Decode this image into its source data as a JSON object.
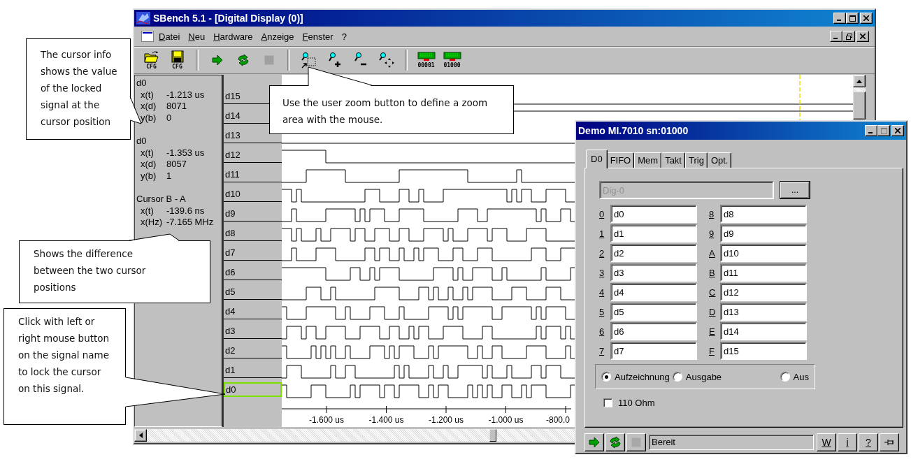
{
  "window": {
    "title": "SBench 5.1 - [Digital Display (0)]"
  },
  "menu": [
    "Datei",
    "Neu",
    "Hardware",
    "Anzeige",
    "Fenster",
    "?"
  ],
  "toolbar": [
    {
      "kind": "open",
      "caption": "CFG",
      "disabled": false
    },
    {
      "kind": "save",
      "caption": "CFG",
      "disabled": false
    },
    {
      "kind": "separator"
    },
    {
      "kind": "run",
      "disabled": false
    },
    {
      "kind": "refresh",
      "disabled": false
    },
    {
      "kind": "stop",
      "disabled": true
    },
    {
      "kind": "separator"
    },
    {
      "kind": "zoom-area",
      "disabled": false
    },
    {
      "kind": "zoom-in",
      "disabled": false
    },
    {
      "kind": "zoom-out",
      "disabled": false
    },
    {
      "kind": "zoom-fit",
      "disabled": false
    },
    {
      "kind": "separator"
    },
    {
      "kind": "board",
      "caption": "00001",
      "disabled": false
    },
    {
      "kind": "board",
      "caption": "01000",
      "disabled": false
    }
  ],
  "cursor_info": [
    {
      "title": "d0",
      "rows": [
        {
          "label": "x(t)",
          "value": "-1.213 us"
        },
        {
          "label": "x(d)",
          "value": "8071"
        },
        {
          "label": "y(b)",
          "value": "0"
        }
      ]
    },
    {
      "title": "d0",
      "rows": [
        {
          "label": "x(t)",
          "value": "-1.353 us"
        },
        {
          "label": "x(d)",
          "value": "8057"
        },
        {
          "label": "y(b)",
          "value": "1"
        }
      ]
    },
    {
      "title": "Cursor B - A",
      "rows": [
        {
          "label": "x(t)",
          "value": "-139.6 ns"
        },
        {
          "label": "x(Hz)",
          "value": "-7.165 MHz"
        }
      ]
    }
  ],
  "signals": [
    {
      "name": "d15",
      "selected": false
    },
    {
      "name": "d14",
      "selected": false
    },
    {
      "name": "d13",
      "selected": false
    },
    {
      "name": "d12",
      "selected": false
    },
    {
      "name": "d11",
      "selected": false
    },
    {
      "name": "d10",
      "selected": false
    },
    {
      "name": "d9",
      "selected": false
    },
    {
      "name": "d8",
      "selected": false
    },
    {
      "name": "d7",
      "selected": false
    },
    {
      "name": "d6",
      "selected": false
    },
    {
      "name": "d5",
      "selected": false
    },
    {
      "name": "d4",
      "selected": false
    },
    {
      "name": "d3",
      "selected": false
    },
    {
      "name": "d2",
      "selected": false
    },
    {
      "name": "d1",
      "selected": false
    },
    {
      "name": "d0",
      "selected": true
    }
  ],
  "time_axis": [
    "-1.600 us",
    "-1.400 us",
    "-1.200 us",
    "-1.000 us",
    "-800.0"
  ],
  "callouts": [
    {
      "text": "The cursor info shows the value of the locked signal at the cursor position"
    },
    {
      "text": "Use the user zoom button to define a zoom area with the mouse."
    },
    {
      "text": "Shows the difference between the two cursor positions"
    },
    {
      "text": "Click with left or right mouse button on the signal name to lock the cursor on this signal."
    }
  ],
  "dialog": {
    "title": "Demo MI.7010 sn:01000",
    "tabs": [
      {
        "label": "D0",
        "selected": true
      },
      {
        "label": "FIFO",
        "selected": false
      },
      {
        "label": "Mem",
        "selected": false
      },
      {
        "label": "Takt",
        "selected": false
      },
      {
        "label": "Trig",
        "selected": false
      },
      {
        "label": "Opt.",
        "selected": false
      }
    ],
    "name_field": {
      "value": "Dig-0",
      "disabled": true
    },
    "browse_button": "...",
    "channels": [
      {
        "key": "0",
        "name": "d0"
      },
      {
        "key": "1",
        "name": "d1"
      },
      {
        "key": "2",
        "name": "d2"
      },
      {
        "key": "3",
        "name": "d3"
      },
      {
        "key": "4",
        "name": "d4"
      },
      {
        "key": "5",
        "name": "d5"
      },
      {
        "key": "6",
        "name": "d6"
      },
      {
        "key": "7",
        "name": "d7"
      },
      {
        "key": "8",
        "name": "d8"
      },
      {
        "key": "9",
        "name": "d9"
      },
      {
        "key": "A",
        "name": "d10"
      },
      {
        "key": "B",
        "name": "d11"
      },
      {
        "key": "C",
        "name": "d12"
      },
      {
        "key": "D",
        "name": "d13"
      },
      {
        "key": "E",
        "name": "d14"
      },
      {
        "key": "F",
        "name": "d15"
      }
    ],
    "modes": [
      {
        "label": "Aufzeichnung",
        "selected": true
      },
      {
        "label": "Ausgabe",
        "selected": false
      },
      {
        "label": "Aus",
        "selected": false
      }
    ],
    "termination": {
      "label": "110 Ohm",
      "checked": false
    },
    "footer": {
      "buttons": [
        {
          "kind": "run",
          "disabled": false
        },
        {
          "kind": "refresh",
          "disabled": false
        },
        {
          "kind": "stop",
          "disabled": true
        }
      ],
      "status": "Bereit",
      "tools": [
        {
          "kind": "text",
          "label": "W"
        },
        {
          "kind": "text",
          "label": "i"
        },
        {
          "kind": "text",
          "label": "?"
        },
        {
          "kind": "pin"
        }
      ]
    }
  }
}
